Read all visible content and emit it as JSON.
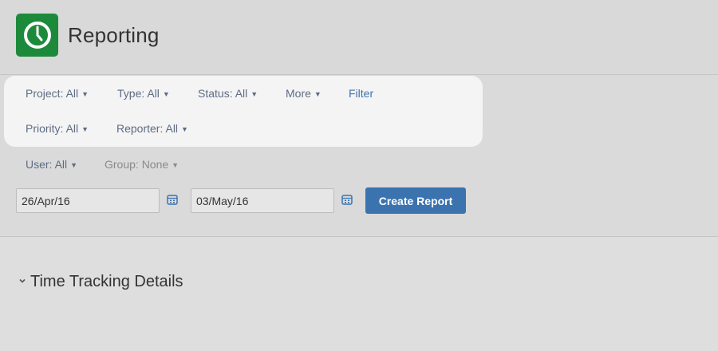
{
  "app": {
    "title": "Reporting",
    "logo_icon": "clock-icon",
    "logo_color": "#1d8a3b"
  },
  "filters": {
    "project": "Project: All",
    "type": "Type: All",
    "status": "Status: All",
    "more": "More",
    "filter_link": "Filter",
    "priority": "Priority: All",
    "reporter": "Reporter: All",
    "user": "User: All",
    "group": "Group: None"
  },
  "dates": {
    "start": "26/Apr/16",
    "end": "03/May/16",
    "calendar_icon": "calendar-icon"
  },
  "actions": {
    "create_report": "Create Report",
    "accent": "#3b73af"
  },
  "section": {
    "title": "Time Tracking Details",
    "toggle_icon": "chevron-down-icon"
  }
}
